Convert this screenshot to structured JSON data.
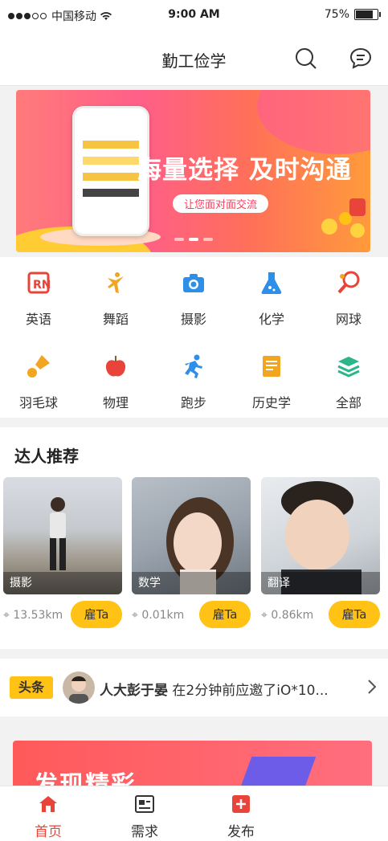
{
  "status_bar": {
    "carrier": "中国移动",
    "time": "9:00 AM",
    "battery": "75%"
  },
  "header": {
    "title": "勤工俭学"
  },
  "banner": {
    "headline": "海量选择 及时沟通",
    "subline": "让您面对面交流"
  },
  "categories": [
    {
      "label": "英语",
      "icon": "english-book-icon",
      "color": "#e8443a"
    },
    {
      "label": "舞蹈",
      "icon": "dancer-icon",
      "color": "#f2a521"
    },
    {
      "label": "摄影",
      "icon": "camera-icon",
      "color": "#2d8fe8"
    },
    {
      "label": "化学",
      "icon": "flask-icon",
      "color": "#2d8fe8"
    },
    {
      "label": "网球",
      "icon": "tennis-racket-icon",
      "color": "#e8443a"
    },
    {
      "label": "羽毛球",
      "icon": "shuttlecock-icon",
      "color": "#f2a521"
    },
    {
      "label": "物理",
      "icon": "apple-icon",
      "color": "#e8443a"
    },
    {
      "label": "跑步",
      "icon": "runner-icon",
      "color": "#2d8fe8"
    },
    {
      "label": "历史学",
      "icon": "document-icon",
      "color": "#f2a521"
    },
    {
      "label": "全部",
      "icon": "layers-icon",
      "color": "#2bb58a"
    }
  ],
  "experts": {
    "title": "达人推荐",
    "items": [
      {
        "tag": "摄影",
        "distance": "13.53km",
        "hire": "雇Ta"
      },
      {
        "tag": "数学",
        "distance": "0.01km",
        "hire": "雇Ta"
      },
      {
        "tag": "翻译",
        "distance": "0.86km",
        "hire": "雇Ta"
      }
    ]
  },
  "headline": {
    "badge": "头条",
    "name": "人大彭于晏",
    "text": "在2分钟前应邀了iO*10..."
  },
  "promo": {
    "text": "发现精彩"
  },
  "tabbar": {
    "tabs": [
      {
        "label": "首页",
        "active": true
      },
      {
        "label": "需求",
        "active": false
      },
      {
        "label": "发布",
        "active": false
      }
    ],
    "active_color": "#e8443a"
  }
}
